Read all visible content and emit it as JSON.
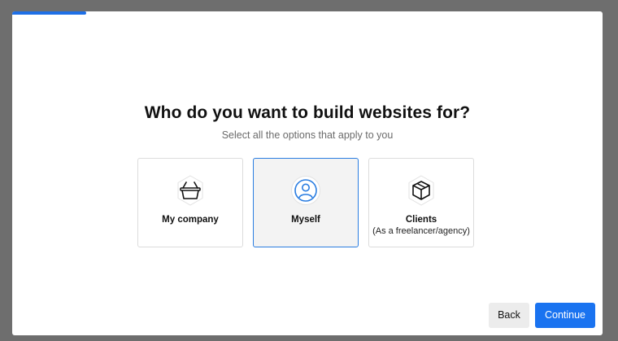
{
  "progress": {
    "fraction": 0.125,
    "color": "#1e6fe6"
  },
  "header": {
    "title": "Who do you want to build websites for?",
    "subtitle": "Select all the options that apply to you"
  },
  "options": [
    {
      "label": "My company",
      "sublabel": "",
      "icon": "basket-icon",
      "selected": false
    },
    {
      "label": "Myself",
      "sublabel": "",
      "icon": "user-icon",
      "selected": true
    },
    {
      "label": "Clients",
      "sublabel": "(As a freelancer/agency)",
      "icon": "box-icon",
      "selected": false
    }
  ],
  "footer": {
    "back_label": "Back",
    "continue_label": "Continue"
  },
  "colors": {
    "accent": "#1a73f0",
    "selected_border": "#2a7de1",
    "overlay": "#6e6e6e"
  }
}
